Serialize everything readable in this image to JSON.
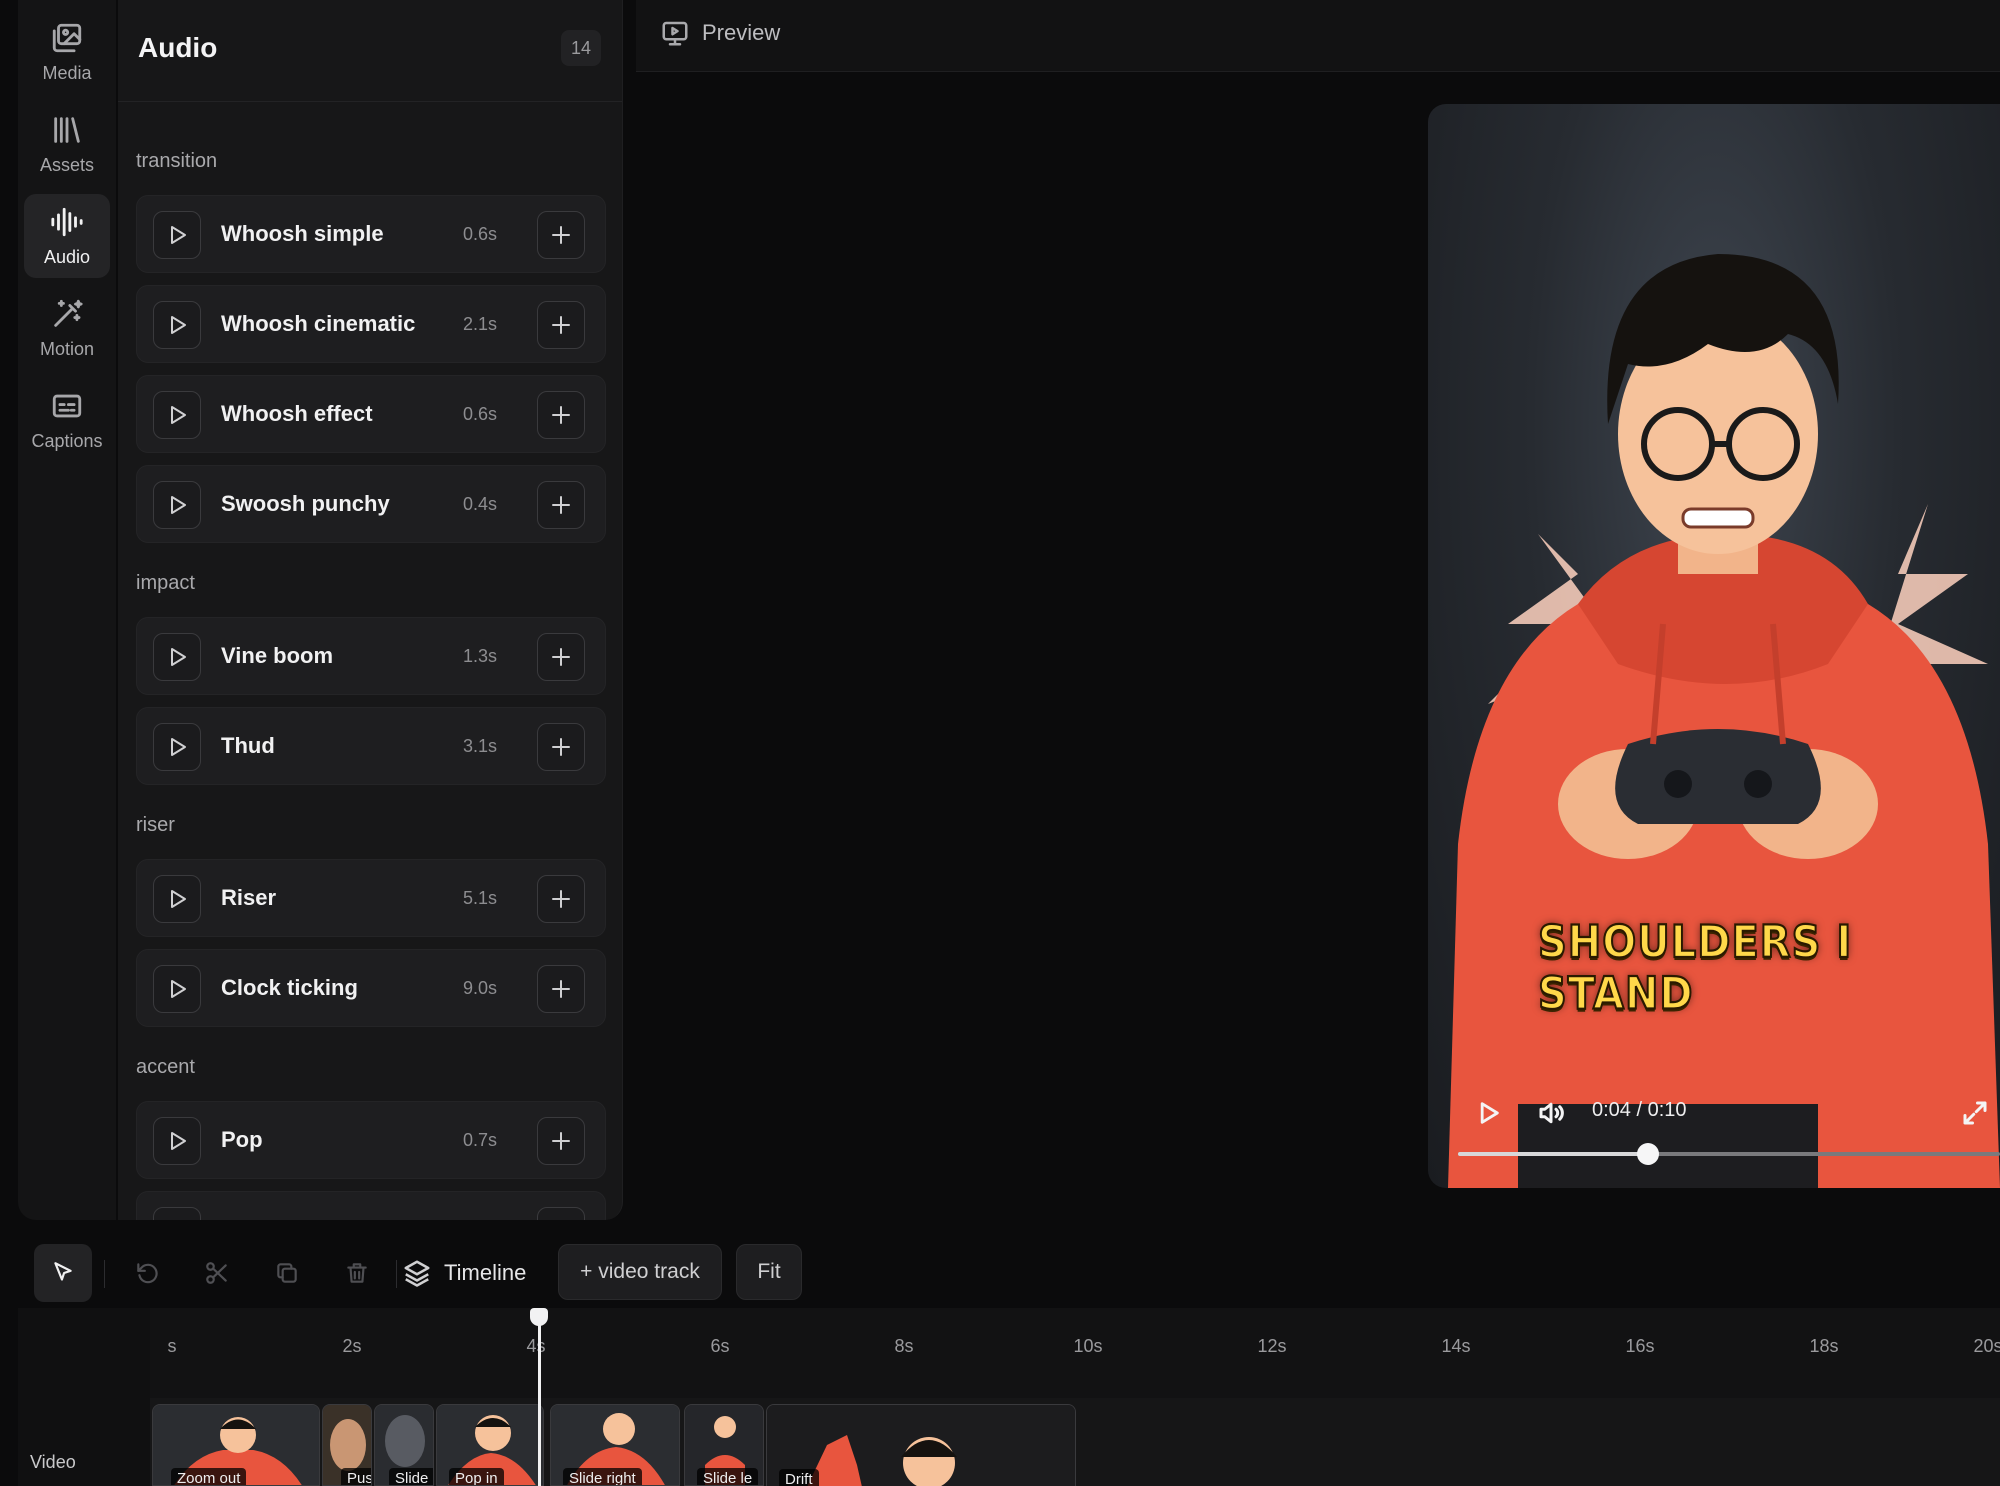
{
  "sidebar": {
    "items": [
      {
        "label": "Media",
        "icon": "media-icon"
      },
      {
        "label": "Assets",
        "icon": "library-icon"
      },
      {
        "label": "Audio",
        "icon": "waveform-icon",
        "active": true
      },
      {
        "label": "Motion",
        "icon": "magic-wand-icon"
      },
      {
        "label": "Captions",
        "icon": "captions-icon"
      }
    ]
  },
  "panel": {
    "title": "Audio",
    "count": "14",
    "sections": [
      {
        "label": "transition",
        "sounds": [
          {
            "name": "Whoosh simple",
            "duration": "0.6s"
          },
          {
            "name": "Whoosh cinematic",
            "duration": "2.1s"
          },
          {
            "name": "Whoosh effect",
            "duration": "0.6s"
          },
          {
            "name": "Swoosh punchy",
            "duration": "0.4s"
          }
        ]
      },
      {
        "label": "impact",
        "sounds": [
          {
            "name": "Vine boom",
            "duration": "1.3s"
          },
          {
            "name": "Thud",
            "duration": "3.1s"
          }
        ]
      },
      {
        "label": "riser",
        "sounds": [
          {
            "name": "Riser",
            "duration": "5.1s"
          },
          {
            "name": "Clock ticking",
            "duration": "9.0s"
          }
        ]
      },
      {
        "label": "accent",
        "sounds": [
          {
            "name": "Pop",
            "duration": "0.7s"
          }
        ]
      }
    ]
  },
  "preview": {
    "label": "Preview",
    "caption": "SHOULDERS I STAND",
    "time": "0:04 / 0:10",
    "progress": 0.35
  },
  "toolbar": {
    "timeline_label": "Timeline",
    "add_track_label": "+ video track",
    "fit_label": "Fit"
  },
  "timeline": {
    "ticks": [
      "s",
      "2s",
      "4s",
      "6s",
      "8s",
      "10s",
      "12s",
      "14s",
      "16s",
      "18s",
      "20s"
    ],
    "track_label": "Video",
    "clips": [
      {
        "label": "Zoom out"
      },
      {
        "label": "Pus"
      },
      {
        "label": "Slide l"
      },
      {
        "label": "Pop in"
      },
      {
        "label": "Slide right"
      },
      {
        "label": "Slide le"
      },
      {
        "label": "Drift"
      }
    ]
  },
  "colors": {
    "background": "#0b0b0c",
    "panel": "#171718",
    "caption": "#ffd84a",
    "hoodie": "#e8553e"
  }
}
